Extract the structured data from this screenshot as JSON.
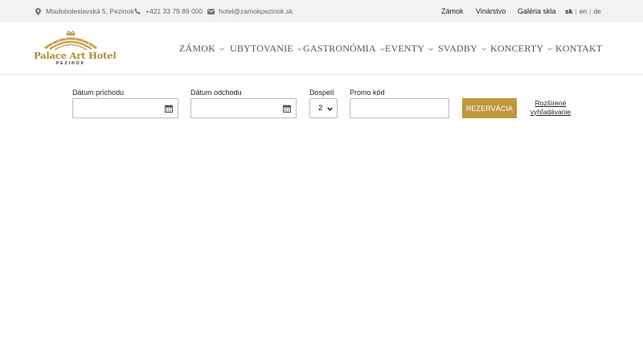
{
  "topbar": {
    "address": "Mladoboleslavská 5, Pezinok",
    "phone": "+421 33 79 89 000",
    "email": "hotel@zamokpezinok.sk",
    "links": [
      "Zámok",
      "Vinárstvo",
      "Galéria skla"
    ],
    "languages": [
      "sk",
      "en",
      "de"
    ],
    "active_language": "sk"
  },
  "logo": {
    "title": "Palace Art Hotel",
    "subtitle": "PEZINOK"
  },
  "nav": {
    "items": [
      "ZÁMOK",
      "UBYTOVANIE",
      "GASTRONÓMIA",
      "EVENTY",
      "SVADBY",
      "KONCERTY",
      "KONTAKT"
    ]
  },
  "booking": {
    "arrival_label": "Dátum príchodu",
    "arrival_value": "",
    "departure_label": "Dátum odchodu",
    "departure_value": "",
    "adults_label": "Dospelí",
    "adults_value": "2",
    "promo_label": "Promo kód",
    "promo_value": "",
    "submit_label": "REZERVÁCIA",
    "advanced_line1": "Rozšírené",
    "advanced_line2": "vyhľadávanie"
  },
  "colors": {
    "accent": "#c2963f",
    "logo_gold": "#b08a35",
    "topbar_bg": "#f2f2f2"
  }
}
